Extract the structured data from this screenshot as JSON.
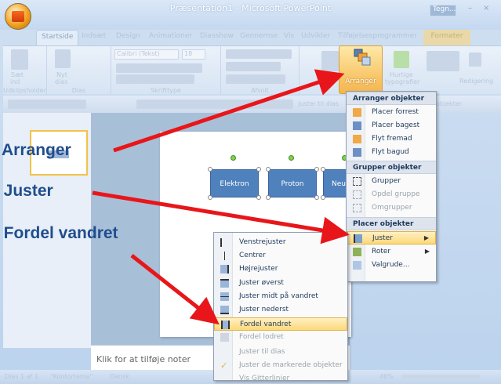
{
  "window": {
    "title": "Præsentation1 - Microsoft PowerPoint",
    "tegn_label": "Tegn...",
    "minimize": "–",
    "close": "×"
  },
  "tabs": [
    "Startside",
    "Indsæt",
    "Design",
    "Animationer",
    "Diasshow",
    "Gennemse",
    "Vis",
    "Udvikler",
    "Tilføjelsesprogrammer"
  ],
  "contextual_tab": "Formater",
  "ribbon": {
    "groups": [
      "Udklipsholder",
      "Dias",
      "Skrifttype",
      "Afsnit",
      "Redigering"
    ],
    "font_name": "Calibri (Tekst)",
    "font_size": "18",
    "slide_label_top": "Nyt",
    "slide_label_bottom": "dias",
    "paste_top": "Sæt",
    "paste_bottom": "ind",
    "arrange_label": "Arranger",
    "quick_styles_top": "Hurtige",
    "quick_styles_bottom": "typografier",
    "edit_label": "Redigering"
  },
  "qat": {
    "align_hint": "Juster til dias",
    "objects_hint": "objekter"
  },
  "slide": {
    "shapes": [
      "Elektron",
      "Proton",
      "Neut"
    ]
  },
  "notes_placeholder": "Klik for at tilføje noter",
  "status": {
    "slide": "Dias 1 af 1",
    "theme": "\"Kontortema\"",
    "language": "Dansk",
    "zoom": "46%"
  },
  "arrange_menu": {
    "header_order": "Arranger objekter",
    "order_items": [
      "Placer forrest",
      "Placer bagest",
      "Flyt fremad",
      "Flyt bagud"
    ],
    "header_group": "Grupper objekter",
    "group_items": [
      "Grupper",
      "Opdel gruppe",
      "Omgrupper"
    ],
    "header_place": "Placer objekter",
    "place_items": [
      "Juster",
      "Roter",
      "Valgrude..."
    ]
  },
  "align_menu": {
    "items": [
      "Venstrejuster",
      "Centrer",
      "Højrejuster",
      "Juster øverst",
      "Juster midt på vandret",
      "Juster nederst",
      "Fordel vandret",
      "Fordel lodret",
      "Juster til dias",
      "Juster de markerede objekter",
      "Vis Gitterlinjer"
    ]
  },
  "callouts": [
    "Arranger",
    "Juster",
    "Fordel vandret"
  ],
  "callout_prefix": "g",
  "colors": {
    "accent": "#4f81bd",
    "arrow": "#e8161a",
    "highlight": "#fcd87a",
    "callout": "#1f4e8c"
  }
}
